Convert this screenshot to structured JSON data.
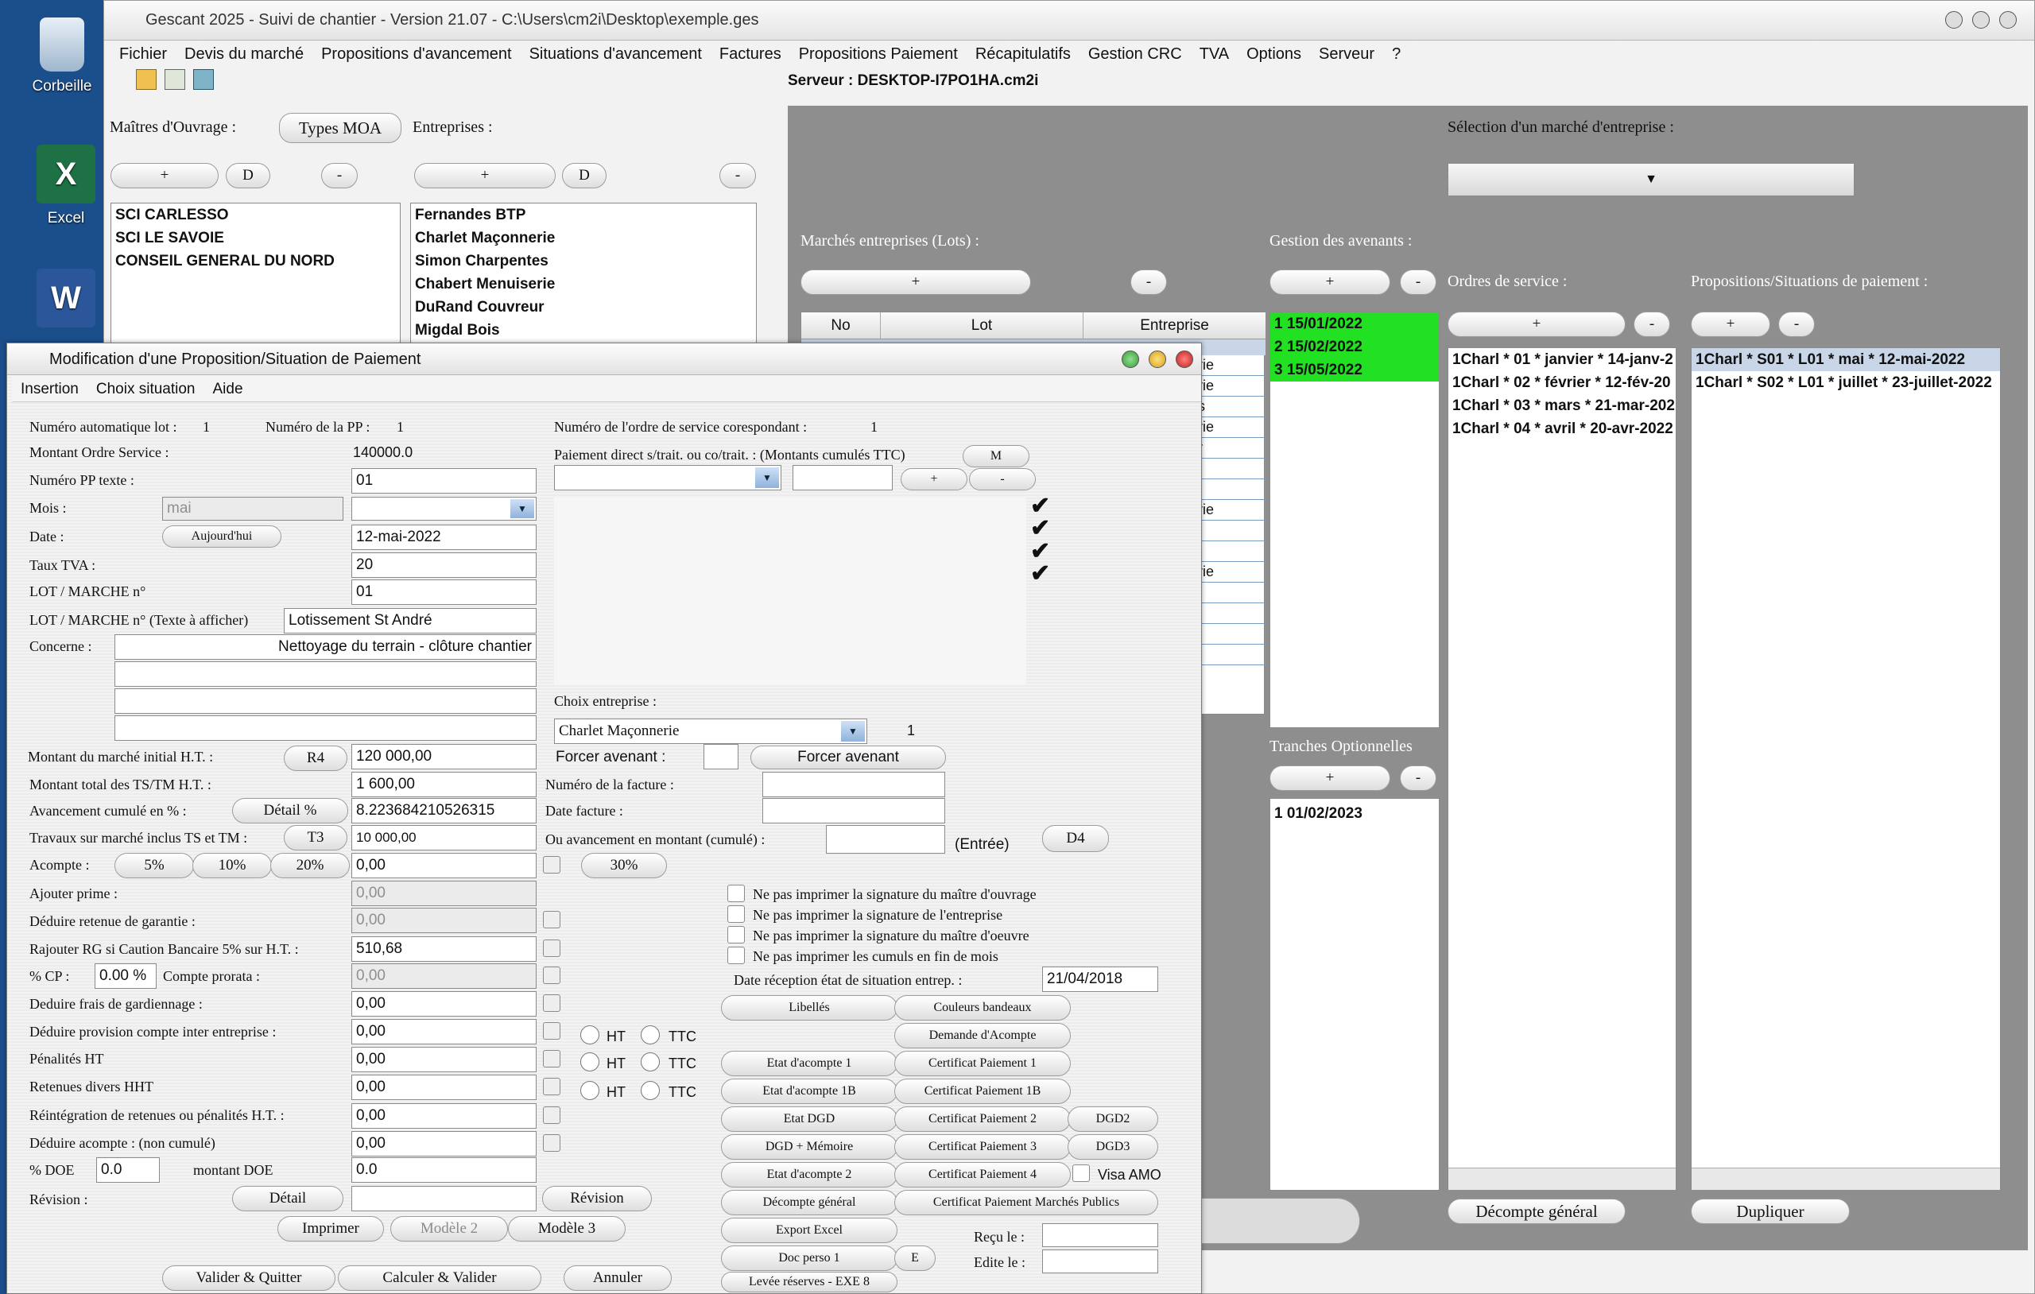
{
  "desktop": {
    "icons": [
      {
        "label": "Corbeille"
      },
      {
        "label": "Excel"
      },
      {
        "label": "Word"
      }
    ]
  },
  "main_window": {
    "title": "Gescant 2025 - Suivi de chantier - Version 21.07 - C:\\Users\\cm2i\\Desktop\\exemple.ges",
    "menu": [
      "Fichier",
      "Devis du marché",
      "Propositions d'avancement",
      "Situations d'avancement",
      "Factures",
      "Propositions Paiement",
      "Récapitulatifs",
      "Gestion CRC",
      "TVA",
      "Options",
      "Serveur",
      "?"
    ],
    "server": "Serveur : DESKTOP-I7PO1HA.cm2i",
    "moa_label": "Maîtres d'Ouvrage :",
    "types_moa": "Types MOA",
    "entreprises_label": "Entreprises :",
    "plus": "+",
    "minus": "-",
    "d": "D",
    "moa_list": [
      "SCI CARLESSO",
      "SCI LE SAVOIE",
      "CONSEIL GENERAL DU NORD"
    ],
    "entreprises_list": [
      "Fernandes BTP",
      "Charlet Maçonnerie",
      "Simon Charpentes",
      "Chabert Menuiserie",
      "DuRand Couvreur",
      "Migdal Bois"
    ],
    "selection_label": "Sélection d'un marché d'entreprise :",
    "marches_label": "Marchés entreprises (Lots) :",
    "lots_headers": [
      "No",
      "Lot",
      "Entreprise"
    ],
    "lots_partial": [
      "rie",
      "rie",
      "s",
      "rie",
      "r",
      "",
      "",
      "rie",
      "",
      "",
      "rie",
      "",
      "",
      "",
      ""
    ],
    "avenants_label": "Gestion des avenants :",
    "avenants": [
      "1 15/01/2022",
      "2 15/02/2022",
      "3 15/05/2022"
    ],
    "tranches_label": "Tranches Optionnelles",
    "tranches": [
      "1 01/02/2023"
    ],
    "os_label": "Ordres de service :",
    "os_list": [
      "1Charl * 01 * janvier * 14-janv-2",
      "1Charl * 02 * février * 12-fév-20",
      "1Charl * 03 * mars * 21-mar-202",
      "1Charl * 04 * avril * 20-avr-2022"
    ],
    "pp_label": "Propositions/Situations de paiement :",
    "pp_list": [
      "1Charl * S01 * L01 * mai * 12-mai-2022",
      "1Charl * S02 * L01 * juillet * 23-juillet-2022"
    ],
    "decompte_btn": "Décompte général",
    "dupliquer_btn": "Dupliquer"
  },
  "dialog": {
    "title": "Modification d'une Proposition/Situation de Paiement",
    "menu": [
      "Insertion",
      "Choix situation",
      "Aide"
    ],
    "num_auto_label": "Numéro automatique lot :",
    "num_auto": "1",
    "num_pp_label": "Numéro de la PP :",
    "num_pp": "1",
    "num_os_label": "Numéro de l'ordre de service corespondant :",
    "num_os": "1",
    "montant_os_label": "Montant Ordre Service :",
    "montant_os": "140000.0",
    "pp_texte_label": "Numéro PP texte :",
    "pp_texte": "01",
    "mois_label": "Mois :",
    "mois_placeholder": "mai",
    "mois_value": "",
    "date_label": "Date :",
    "aujourdhui": "Aujourd'hui",
    "date": "12-mai-2022",
    "tva_label": "Taux TVA :",
    "tva": "20",
    "lot_label": "LOT / MARCHE n°",
    "lot": "01",
    "lot_texte_label": "LOT / MARCHE n° (Texte à afficher)",
    "lot_texte": "Lotissement St André",
    "concerne_label": "Concerne :",
    "concerne": "Nettoyage du terrain - clôture chantier",
    "paiement_direct_label": "Paiement direct s/trait. ou co/trait. : (Montants cumulés TTC)",
    "m_btn": "M",
    "choix_ent_label": "Choix entreprise :",
    "choix_ent": "Charlet Maçonnerie",
    "choix_ent_num": "1",
    "montant_init_label": "Montant du marché initial H.T. :",
    "r4": "R4",
    "montant_init": "120 000,00",
    "forcer_label": "Forcer avenant :",
    "forcer_btn": "Forcer avenant",
    "ts_tm_label": "Montant total des TS/TM H.T. :",
    "ts_tm": "1 600,00",
    "num_facture_label": "Numéro de la facture :",
    "avancement_label": "Avancement cumulé en % :",
    "detail_pct": "Détail %",
    "avancement": "8.223684210526315",
    "date_facture_label": "Date facture :",
    "travaux_label": "Travaux sur marché inclus TS et TM :",
    "t3": "T3",
    "travaux": "10 000,00",
    "ou_avancement_label": "Ou avancement en montant (cumulé) :",
    "entree": "(Entrée)",
    "d4": "D4",
    "acompte_label": "Acompte :",
    "p5": "5%",
    "p10": "10%",
    "p20": "20%",
    "acompte": "0,00",
    "p30": "30%",
    "prime_label": "Ajouter prime :",
    "prime": "0,00",
    "retenue_label": "Déduire retenue de garantie :",
    "retenue": "0,00",
    "rg_label": "Rajouter RG si Caution Bancaire 5% sur H.T. :",
    "rg": "510,68",
    "cp_label": "% CP :",
    "cp": "0.00 %",
    "prorata_label": "Compte prorata :",
    "prorata": "0,00",
    "gardiennage_label": "Deduire frais de gardiennage :",
    "gardiennage": "0,00",
    "provision_label": "Déduire provision compte inter entreprise :",
    "provision": "0,00",
    "penalites_label": "Pénalités HT",
    "penalites": "0,00",
    "retenues_label": "Retenues divers HHT",
    "retenues": "0,00",
    "reintegration_label": "Réintégration de retenues ou pénalités H.T. :",
    "reintegration": "0,00",
    "deduire_acompte_label": "Déduire acompte : (non cumulé)",
    "deduire_acompte": "0,00",
    "doe_label": "% DOE",
    "doe": "0.0",
    "montant_doe_label": "montant DOE",
    "montant_doe": "0.0",
    "revision_label": "Révision :",
    "detail": "Détail",
    "revision_btn": "Révision",
    "imprimer": "Imprimer",
    "modele2": "Modèle 2",
    "modele3": "Modèle 3",
    "valider_quitter": "Valider & Quitter",
    "calculer": "Calculer & Valider",
    "annuler": "Annuler",
    "ht": "HT",
    "ttc": "TTC",
    "print_opts": [
      "Ne pas imprimer la signature du maître d'ouvrage",
      "Ne pas imprimer la signature de l'entreprise",
      "Ne pas imprimer la signature du maître d'oeuvre",
      "Ne pas imprimer les cumuls en fin de mois"
    ],
    "date_reception_label": "Date réception état de situation entrep. :",
    "date_reception": "21/04/2018",
    "libelles": "Libellés",
    "couleurs": "Couleurs bandeaux",
    "demande": "Demande d'Acompte",
    "etat1": "Etat d'acompte 1",
    "cert1": "Certificat Paiement 1",
    "etat1b": "Etat d'acompte 1B",
    "cert1b": "Certificat Paiement 1B",
    "etat_dgd": "Etat DGD",
    "cert2": "Certificat Paiement 2",
    "dgd2": "DGD2",
    "dgd_memoire": "DGD + Mémoire",
    "cert3": "Certificat Paiement 3",
    "dgd3": "DGD3",
    "etat2": "Etat d'acompte 2",
    "cert4": "Certificat Paiement 4",
    "visa": "Visa AMO",
    "decompte": "Décompte général",
    "cert_mp": "Certificat Paiement Marchés Publics",
    "export": "Export Excel",
    "doc_perso": "Doc perso 1",
    "e": "E",
    "levee": "Levée réserves - EXE 8",
    "recu_label": "Reçu le :",
    "edite_label": "Edite le :"
  }
}
